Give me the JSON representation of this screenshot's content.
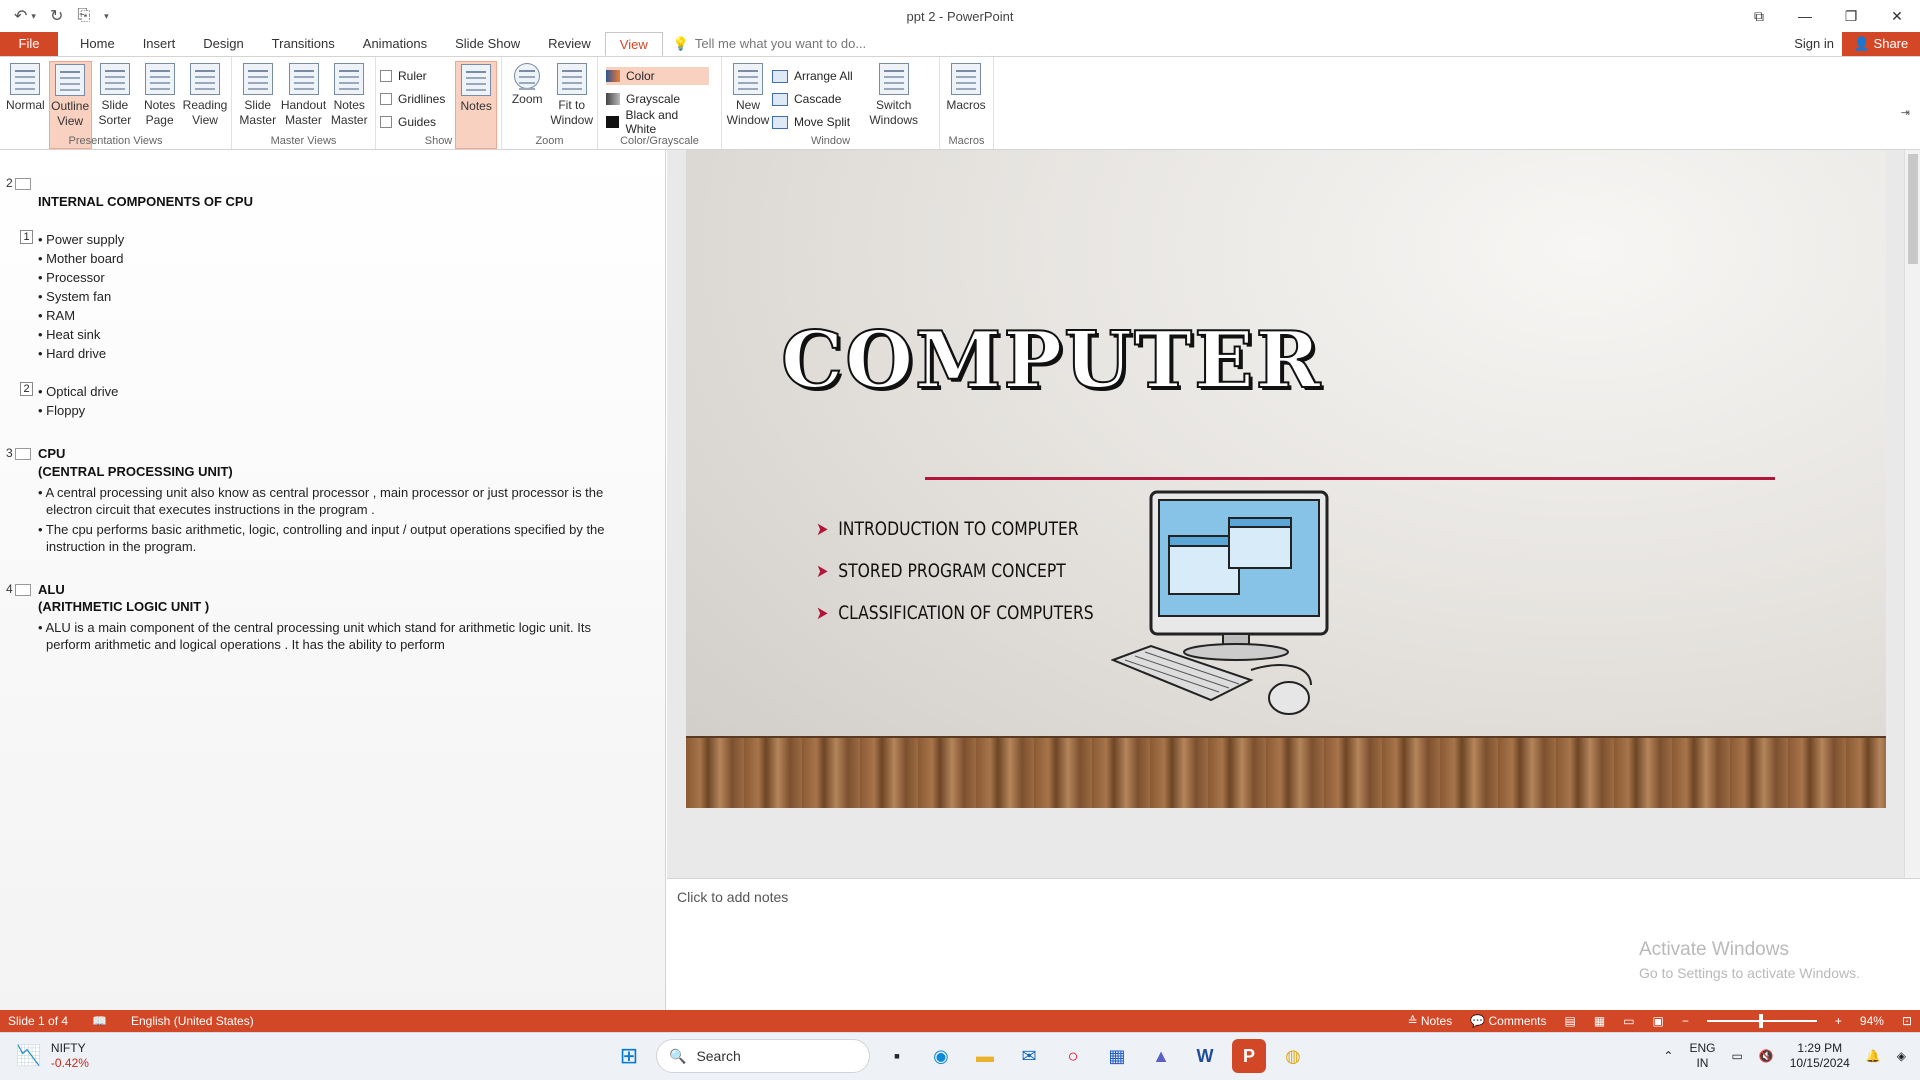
{
  "window": {
    "title": "ppt 2 - PowerPoint",
    "controls": [
      "⧉",
      "—",
      "❐",
      "✕"
    ]
  },
  "qat": [
    "↶",
    "▾",
    "↻",
    "⎘",
    "▾"
  ],
  "tabs": {
    "file": "File",
    "items": [
      "Home",
      "Insert",
      "Design",
      "Transitions",
      "Animations",
      "Slide Show",
      "Review",
      "View"
    ],
    "tell_me": "Tell me what you want to do...",
    "sign_in": "Sign in",
    "share": "Share"
  },
  "ribbon": {
    "presentation_views": {
      "label": "Presentation Views",
      "buttons": [
        "Normal",
        "Outline View",
        "Slide Sorter",
        "Notes Page",
        "Reading View"
      ]
    },
    "master_views": {
      "label": "Master Views",
      "buttons": [
        "Slide Master",
        "Handout Master",
        "Notes Master"
      ]
    },
    "show": {
      "label": "Show",
      "checks": [
        "Ruler",
        "Gridlines",
        "Guides"
      ],
      "notes": "Notes"
    },
    "zoom": {
      "label": "Zoom",
      "buttons": [
        "Zoom",
        "Fit to Window"
      ]
    },
    "color": {
      "label": "Color/Grayscale",
      "items": [
        "Color",
        "Grayscale",
        "Black and White"
      ]
    },
    "window": {
      "label": "Window",
      "new_window": "New Window",
      "items": [
        "Arrange All",
        "Cascade",
        "Move Split"
      ],
      "switch": "Switch Windows"
    },
    "macros": {
      "label": "Macros",
      "button": "Macros"
    }
  },
  "outline": {
    "s2": {
      "num": "2",
      "title": "INTERNAL COMPONENTS OF CPU",
      "level1": "1",
      "list1": [
        "• Power supply",
        "• Mother board",
        "• Processor",
        "• System fan",
        "• RAM",
        "• Heat sink",
        "• Hard drive"
      ],
      "level2": "2",
      "list2": [
        "• Optical drive",
        "• Floppy"
      ]
    },
    "s3": {
      "num": "3",
      "title1": "CPU",
      "title2": "(CENTRAL PROCESSING UNIT)",
      "p1": "• A central processing unit also know as central processor , main processor or just processor is the electron circuit that executes instructions in the program .",
      "p2": "• The cpu performs basic arithmetic, logic, controlling  and input / output operations specified by the instruction in the program."
    },
    "s4": {
      "num": "4",
      "title1": "ALU",
      "title2": "(ARITHMETIC LOGIC UNIT )",
      "p1": "• ALU is a main component of the central processing unit which stand for arithmetic logic unit. Its perform arithmetic and logical operations . It has the ability to perform"
    }
  },
  "slide": {
    "title": "COMPUTER",
    "bullets": [
      "INTRODUCTION TO COMPUTER",
      "STORED PROGRAM CONCEPT",
      "CLASSIFICATION OF COMPUTERS"
    ],
    "accent": "#b1163a"
  },
  "notes": {
    "placeholder": "Click to add notes"
  },
  "activate": {
    "line1": "Activate Windows",
    "line2": "Go to Settings to activate Windows."
  },
  "status": {
    "slide": "Slide 1 of 4",
    "language": "English (United States)",
    "notes": "Notes",
    "comments": "Comments",
    "zoom": "94%",
    "bar_color": "#d24726"
  },
  "taskbar": {
    "ticker": "NIFTY",
    "ticker_value": "-0.42%",
    "search": "Search",
    "lang1": "ENG",
    "lang2": "IN",
    "time": "1:29 PM",
    "date": "10/15/2024"
  }
}
